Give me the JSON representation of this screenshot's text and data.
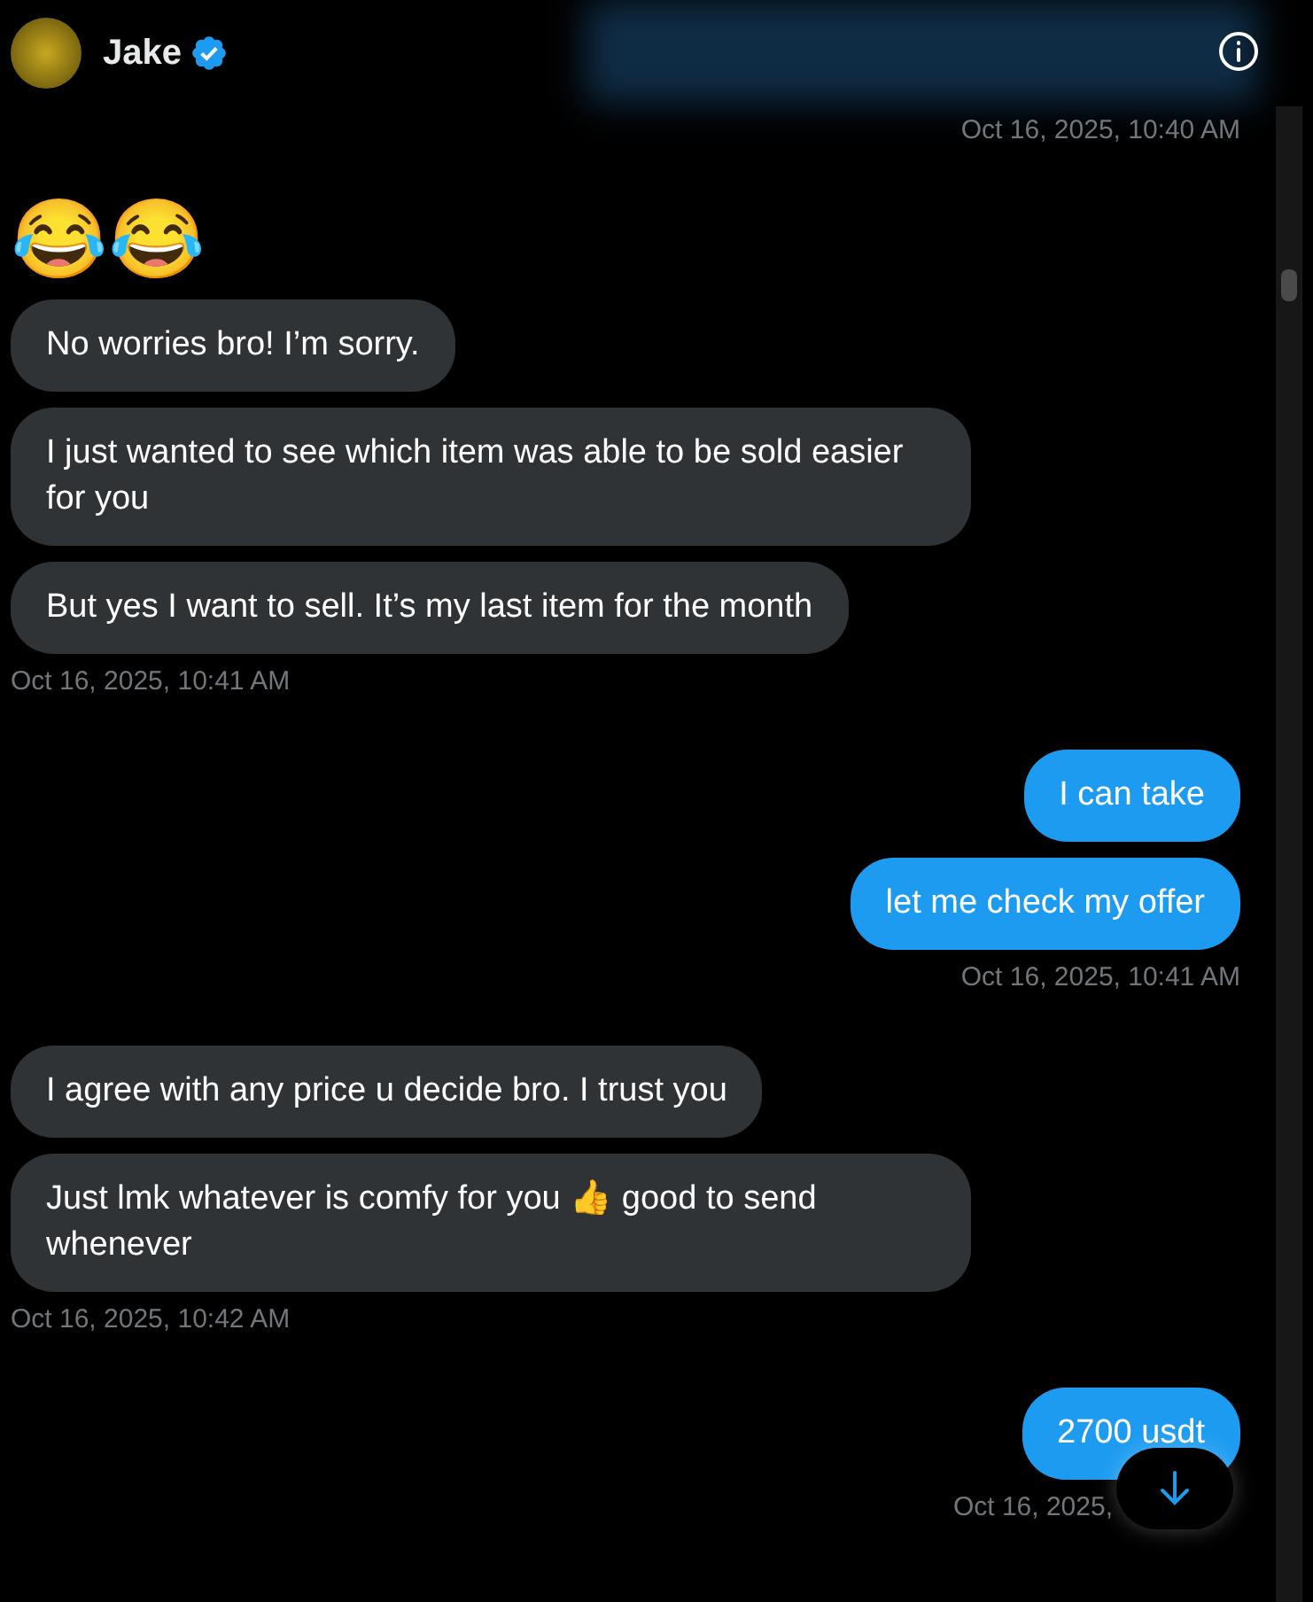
{
  "header": {
    "name": "Jake",
    "verified": true
  },
  "messages": [
    {
      "kind": "timestamp",
      "sent": true,
      "text": "Oct 16, 2025, 10:40 AM"
    },
    {
      "kind": "emoji",
      "text": "😂😂"
    },
    {
      "kind": "bubble",
      "sent": false,
      "text": "No worries bro! I’m sorry."
    },
    {
      "kind": "bubble",
      "sent": false,
      "text": "I just wanted to see which item was able to be sold easier for you"
    },
    {
      "kind": "bubble",
      "sent": false,
      "text": "But yes I want to sell. It’s my last item for the month"
    },
    {
      "kind": "timestamp",
      "sent": false,
      "text": "Oct 16, 2025, 10:41 AM"
    },
    {
      "kind": "bubble",
      "sent": true,
      "text": "I can take"
    },
    {
      "kind": "bubble",
      "sent": true,
      "text": "let me check my offer"
    },
    {
      "kind": "timestamp",
      "sent": true,
      "text": "Oct 16, 2025, 10:41 AM"
    },
    {
      "kind": "bubble",
      "sent": false,
      "text": "I agree with any price u decide bro. I trust you"
    },
    {
      "kind": "bubble",
      "sent": false,
      "text": "Just lmk whatever is comfy for you 👍 good to send whenever"
    },
    {
      "kind": "timestamp",
      "sent": false,
      "text": "Oct 16, 2025, 10:42 AM"
    },
    {
      "kind": "bubble",
      "sent": true,
      "text": "2700 usdt"
    },
    {
      "kind": "timestamp",
      "sent": true,
      "text": "Oct 16, 2025,"
    }
  ]
}
